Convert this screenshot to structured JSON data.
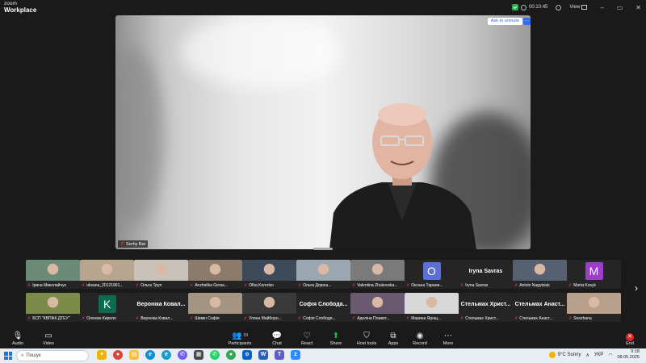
{
  "titlebar": {
    "brand_small": "zoom",
    "brand_big": "Workplace",
    "timer": "00:10:45",
    "view_label": "View",
    "window_controls": [
      "–",
      "▭",
      "✕"
    ]
  },
  "main_video": {
    "speaker_name": "Serhy Bai",
    "unmute_button": "Ask to unmute",
    "more_button": "···"
  },
  "gallery": {
    "row1": [
      {
        "label": "Ірина Миколайчук",
        "kind": "photo",
        "color": "#6b8a78"
      },
      {
        "label": "oksana_20121961...",
        "kind": "photo",
        "color": "#b8a58f"
      },
      {
        "label": "Ольга Труп",
        "kind": "photo",
        "color": "#c8c2b9"
      },
      {
        "label": "Anzhelika Geras...",
        "kind": "photo",
        "color": "#8c7a6a"
      },
      {
        "label": "Olha Korenko",
        "kind": "photo",
        "color": "#3c4a5a"
      },
      {
        "label": "Ольга Дорош...",
        "kind": "photo",
        "color": "#9aa7b0"
      },
      {
        "label": "Valentina Zhukovska...",
        "kind": "photo",
        "color": "#7a7a7a"
      },
      {
        "label": "Оксана Тарани...",
        "kind": "avatar",
        "letter": "O",
        "color": "#5b6fd6"
      },
      {
        "label": "Iryna Savras",
        "kind": "name",
        "big": "Iryna Savras"
      },
      {
        "label": "Antoin Nagytsiuk",
        "kind": "photo",
        "color": "#556070"
      },
      {
        "label": "Marta Kosyk",
        "kind": "avatar",
        "letter": "M",
        "color": "#9b3fc8"
      }
    ],
    "row2": [
      {
        "label": "БСП \"КВПФК ДТЕУ\"",
        "kind": "photo",
        "color": "#7c8a4a"
      },
      {
        "label": "Оленюк Кирило",
        "kind": "avatar",
        "letter": "K",
        "color": "#0f6b4f"
      },
      {
        "label": "Вероніка Ковал...",
        "kind": "name",
        "big": "Вероніка Ковал..."
      },
      {
        "label": "Шимін Софія",
        "kind": "photo",
        "color": "#a49481"
      },
      {
        "label": "Уляна Майборо...",
        "kind": "photo",
        "color": "#3a3a3a"
      },
      {
        "label": "Софія Слободя...",
        "kind": "name",
        "big": "Софія Слобода..."
      },
      {
        "label": "Аделіна Плавот...",
        "kind": "photo",
        "color": "#6a5a70"
      },
      {
        "label": "Марина Ярощ...",
        "kind": "photo",
        "color": "#d8d8d8"
      },
      {
        "label": "Стельмах Христ...",
        "kind": "name",
        "big": "Стельмах Христ..."
      },
      {
        "label": "Стельмах Анаст...",
        "kind": "name",
        "big": "Стельмах Анаст..."
      },
      {
        "label": "Snezhana",
        "kind": "photo",
        "color": "#b9a08c"
      }
    ]
  },
  "toolbar": {
    "audio": "Audio",
    "video": "Video",
    "participants": "Participants",
    "participants_count": "29",
    "chat": "Chat",
    "react": "React",
    "share": "Share",
    "host_tools": "Host tools",
    "apps": "Apps",
    "record": "Record",
    "more": "More",
    "end": "End"
  },
  "taskbar": {
    "search_placeholder": "Пошук",
    "weather": "9°C Sunny",
    "language": "УКР",
    "time": "9:18",
    "date": "08.05.2025"
  }
}
